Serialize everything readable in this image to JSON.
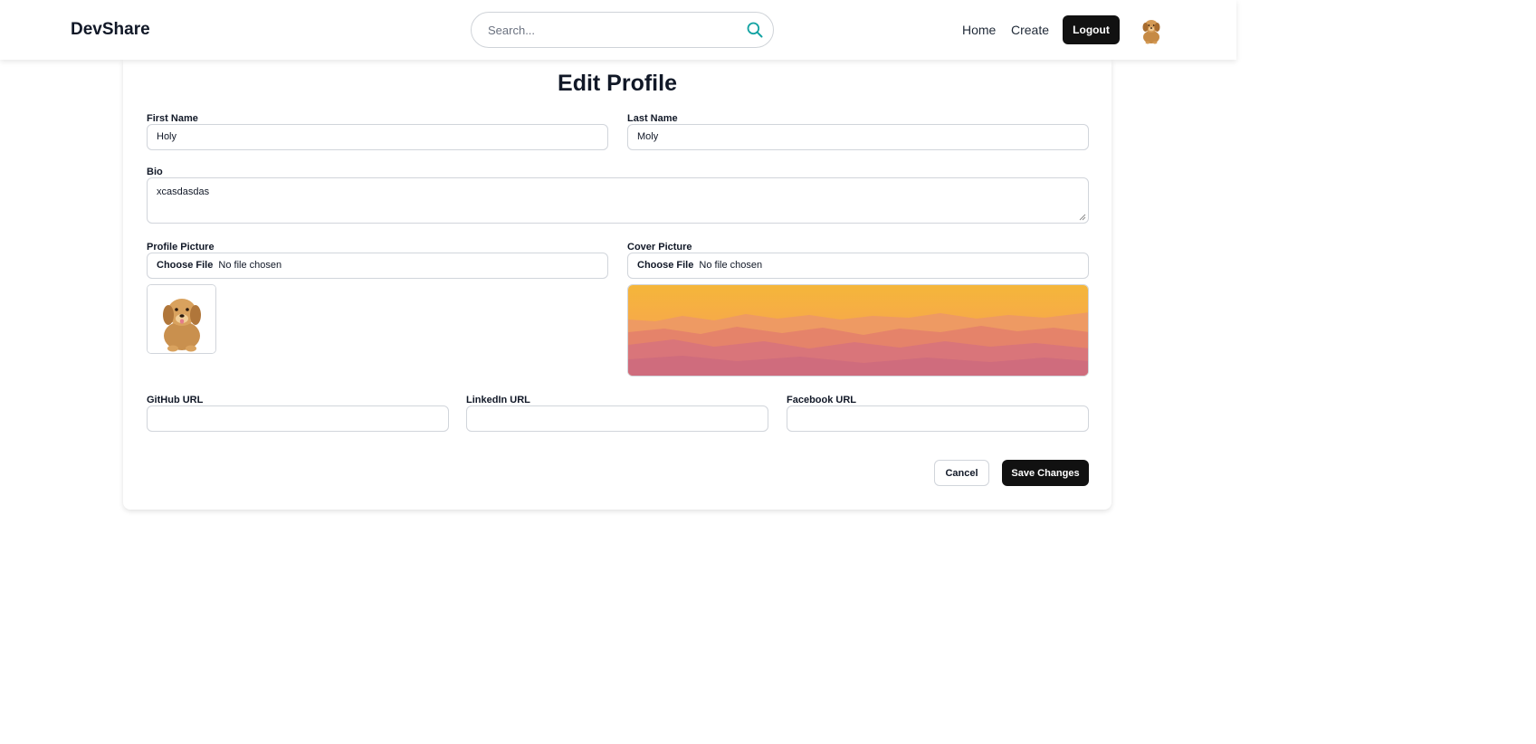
{
  "header": {
    "brand": "DevShare",
    "search_placeholder": "Search...",
    "nav": {
      "home": "Home",
      "create": "Create",
      "logout": "Logout"
    }
  },
  "form": {
    "title": "Edit Profile",
    "first_name": {
      "label": "First Name",
      "value": "Holy"
    },
    "last_name": {
      "label": "Last Name",
      "value": "Moly"
    },
    "bio": {
      "label": "Bio",
      "value": "xcasdasdas"
    },
    "profile_picture": {
      "label": "Profile Picture",
      "button": "Choose File",
      "status": "No file chosen"
    },
    "cover_picture": {
      "label": "Cover Picture",
      "button": "Choose File",
      "status": "No file chosen"
    },
    "github": {
      "label": "GitHub URL",
      "value": ""
    },
    "linkedin": {
      "label": "LinkedIn URL",
      "value": ""
    },
    "facebook": {
      "label": "Facebook URL",
      "value": ""
    },
    "cancel_label": "Cancel",
    "save_label": "Save Changes"
  },
  "colors": {
    "accent": "#14a3a3",
    "primary_button": "#111111",
    "border": "#d1d5db"
  },
  "icons": {
    "search": "search-icon",
    "avatar": "dog-avatar-icon",
    "profile_preview": "puppy-image",
    "cover_preview": "mountain-sunset-image"
  }
}
